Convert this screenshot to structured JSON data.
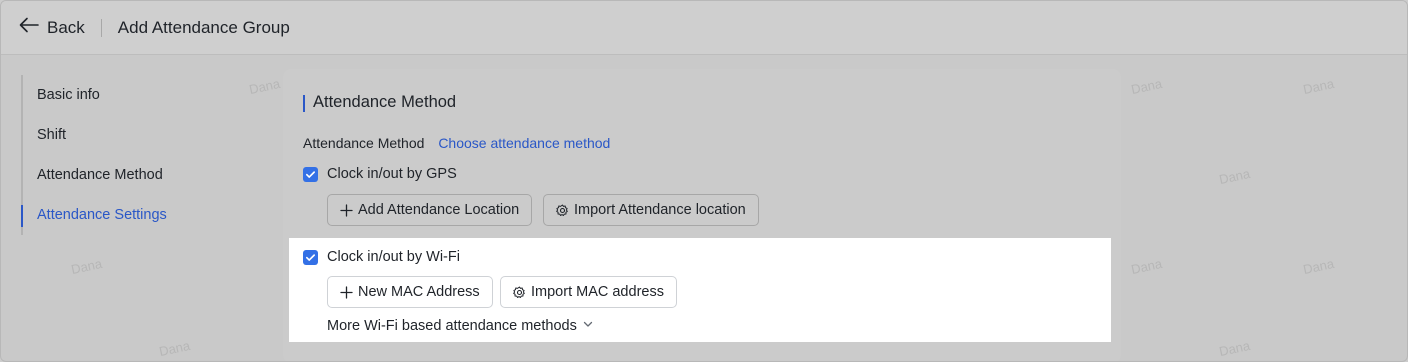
{
  "header": {
    "back_label": "Back",
    "title": "Add Attendance Group"
  },
  "sidebar": {
    "items": [
      {
        "label": "Basic info",
        "active": false
      },
      {
        "label": "Shift",
        "active": false
      },
      {
        "label": "Attendance Method",
        "active": false
      },
      {
        "label": "Attendance Settings",
        "active": true
      }
    ]
  },
  "main": {
    "section_title": "Attendance Method",
    "method_label": "Attendance Method",
    "choose_link": "Choose attendance method",
    "gps": {
      "checkbox_label": "Clock in/out by GPS",
      "checked": true,
      "add_location_label": "Add Attendance Location",
      "import_location_label": "Import Attendance location"
    },
    "wifi": {
      "checkbox_label": "Clock in/out by Wi-Fi",
      "checked": true,
      "new_mac_label": "New MAC Address",
      "import_mac_label": "Import MAC address",
      "more_methods_label": "More Wi-Fi based attendance methods"
    }
  },
  "watermark": "Dana",
  "colors": {
    "accent": "#2a57c7",
    "checkbox": "#3370e6",
    "overlay_bg": "#cbcbcb",
    "highlight_bg": "#ffffff"
  },
  "icons": {
    "back": "arrow-left-icon",
    "add": "plus-icon",
    "import": "gear-icon",
    "check": "checkmark-icon",
    "expand": "chevron-down-icon"
  }
}
